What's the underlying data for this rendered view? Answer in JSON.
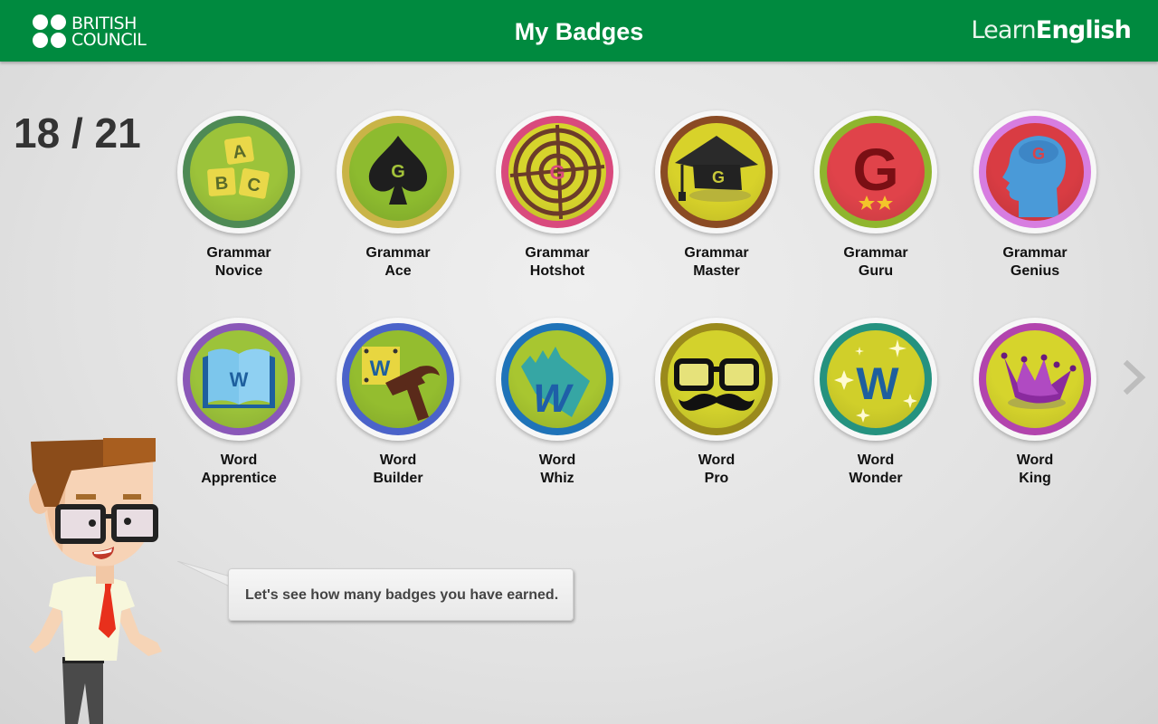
{
  "header": {
    "brand_line1": "BRITISH",
    "brand_line2": "COUNCIL",
    "title": "My Badges",
    "app_logo_light": "Learn",
    "app_logo_bold": "English",
    "brand_color": "#008a3f"
  },
  "progress": {
    "earned": 18,
    "total": 21,
    "text": "18 / 21"
  },
  "badges": [
    {
      "line1": "Grammar",
      "line2": "Novice",
      "icon": "abc-blocks-icon",
      "ring": "#4e8a55",
      "face": "#9cc33a"
    },
    {
      "line1": "Grammar",
      "line2": "Ace",
      "icon": "spade-icon",
      "ring": "#c9b447",
      "face": "#8dbb2f"
    },
    {
      "line1": "Grammar",
      "line2": "Hotshot",
      "icon": "target-icon",
      "ring": "#d94a7d",
      "face": "#d6d42c"
    },
    {
      "line1": "Grammar",
      "line2": "Master",
      "icon": "graduation-cap-icon",
      "ring": "#8a4b24",
      "face": "#d8d22a"
    },
    {
      "line1": "Grammar",
      "line2": "Guru",
      "icon": "g-stars-icon",
      "ring": "#8fb52e",
      "face": "#e0434a"
    },
    {
      "line1": "Grammar",
      "line2": "Genius",
      "icon": "head-icon",
      "ring": "#d77de0",
      "face": "#d93c43"
    },
    {
      "line1": "Word",
      "line2": "Apprentice",
      "icon": "book-icon",
      "ring": "#8a58b8",
      "face": "#9cc33a"
    },
    {
      "line1": "Word",
      "line2": "Builder",
      "icon": "hammer-icon",
      "ring": "#4b63c9",
      "face": "#94bd2f"
    },
    {
      "line1": "Word",
      "line2": "Whiz",
      "icon": "speed-w-icon",
      "ring": "#1f73b8",
      "face": "#a8c630"
    },
    {
      "line1": "Word",
      "line2": "Pro",
      "icon": "glasses-mustache-icon",
      "ring": "#9a8a1c",
      "face": "#d3d22c"
    },
    {
      "line1": "Word",
      "line2": "Wonder",
      "icon": "sparkle-w-icon",
      "ring": "#25927f",
      "face": "#d0cf2a"
    },
    {
      "line1": "Word",
      "line2": "King",
      "icon": "crown-icon",
      "ring": "#b244ad",
      "face": "#d6d42c"
    }
  ],
  "speech": {
    "text": "Let's see how many badges you have earned."
  }
}
